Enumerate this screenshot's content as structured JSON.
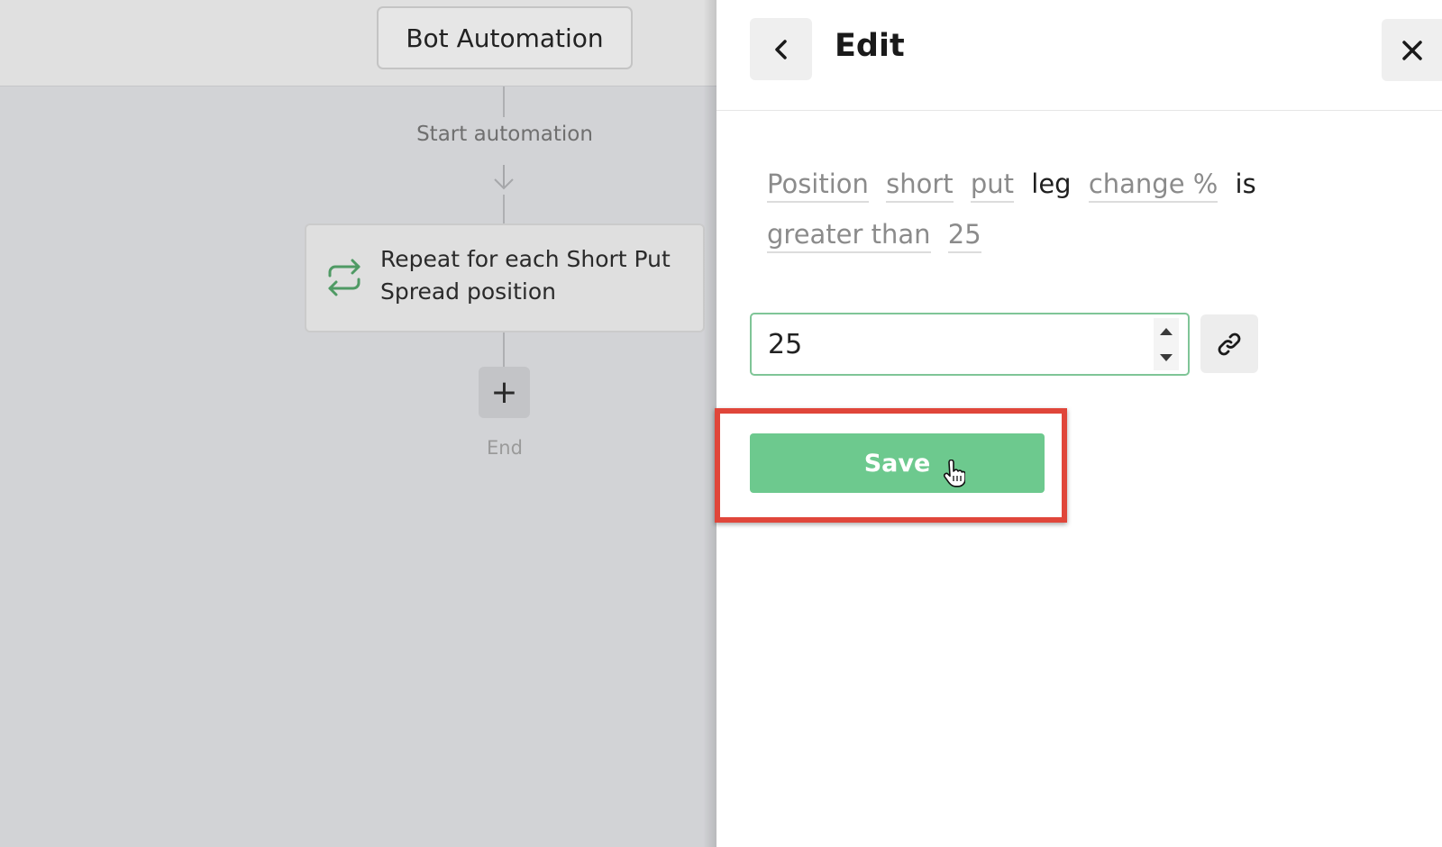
{
  "canvas": {
    "title": "Bot Automation",
    "start_label": "Start automation",
    "repeat_card": {
      "text": "Repeat for each Short Put Spread position",
      "icon": "repeat-icon"
    },
    "add_step_symbol": "+",
    "end_label": "End"
  },
  "panel": {
    "title": "Edit",
    "back_icon": "chevron-left-icon",
    "close_icon": "close-icon",
    "condition": {
      "tokens": [
        {
          "text": "Position",
          "kind": "token"
        },
        {
          "text": "short",
          "kind": "token"
        },
        {
          "text": "put",
          "kind": "token"
        },
        {
          "text": "leg",
          "kind": "plain"
        },
        {
          "text": "change %",
          "kind": "token"
        },
        {
          "text": "is",
          "kind": "plain"
        },
        {
          "text": "greater than",
          "kind": "token"
        },
        {
          "text": "25",
          "kind": "token"
        }
      ]
    },
    "value_input": {
      "value": "25"
    },
    "link_icon": "link-icon",
    "save_label": "Save"
  },
  "colors": {
    "accent_green": "#6dc98e",
    "input_border": "#7fc597",
    "highlight_red": "#e0463a",
    "repeat_icon_green": "#4f9a64"
  }
}
